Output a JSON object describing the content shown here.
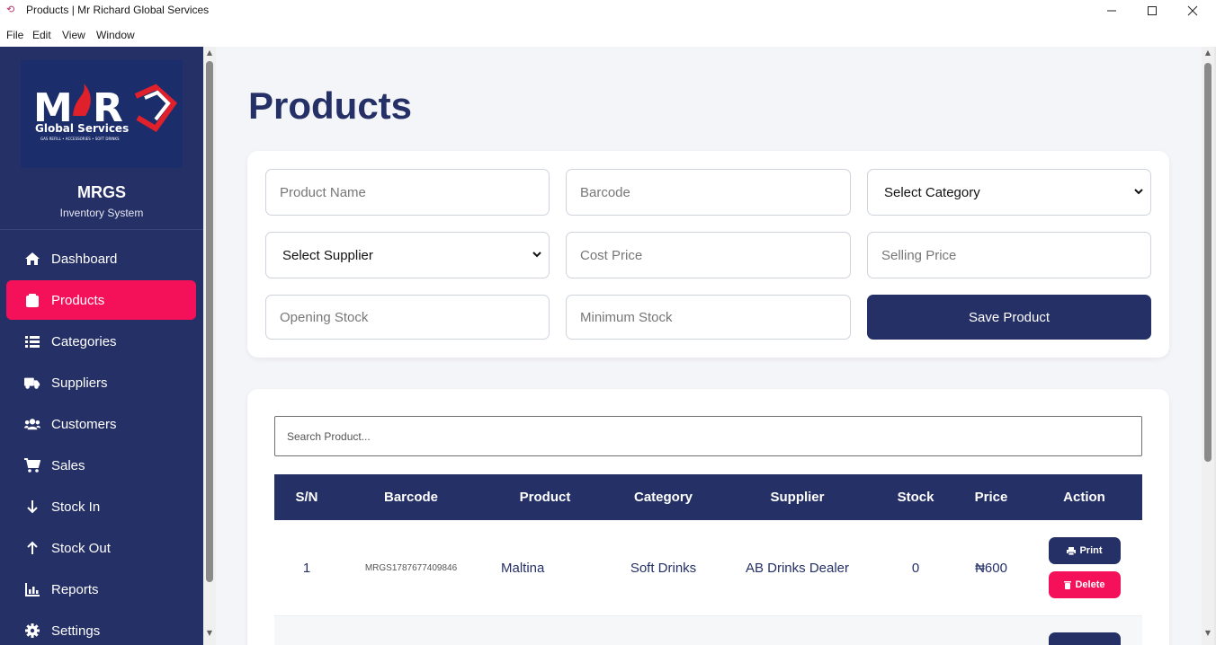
{
  "window": {
    "title": "Products | Mr Richard Global Services",
    "app_icon": "app-logo-icon",
    "controls": [
      "minimize-icon",
      "maximize-icon",
      "close-icon"
    ]
  },
  "menubar": [
    "File",
    "Edit",
    "View",
    "Window"
  ],
  "sidebar": {
    "logo": {
      "line1": "MRGS",
      "line2": "Global Services",
      "tagline": "GAS REFILL • ACCESSORIES • SOFT DRINKS"
    },
    "brand": "MRGS",
    "subtitle": "Inventory System",
    "items": [
      {
        "label": "Dashboard",
        "icon": "home-icon",
        "active": false
      },
      {
        "label": "Products",
        "icon": "box-icon",
        "active": true
      },
      {
        "label": "Categories",
        "icon": "list-icon",
        "active": false
      },
      {
        "label": "Suppliers",
        "icon": "truck-icon",
        "active": false
      },
      {
        "label": "Customers",
        "icon": "users-icon",
        "active": false
      },
      {
        "label": "Sales",
        "icon": "cart-icon",
        "active": false
      },
      {
        "label": "Stock In",
        "icon": "arrow-down-icon",
        "active": false
      },
      {
        "label": "Stock Out",
        "icon": "arrow-up-icon",
        "active": false
      },
      {
        "label": "Reports",
        "icon": "chart-icon",
        "active": false
      },
      {
        "label": "Settings",
        "icon": "gear-icon",
        "active": false
      }
    ]
  },
  "main": {
    "title": "Products",
    "form": {
      "product_name": "Product Name",
      "barcode": "Barcode",
      "category": "Select Category",
      "supplier": "Select Supplier",
      "cost_price": "Cost Price",
      "selling_price": "Selling Price",
      "opening_stock": "Opening Stock",
      "minimum_stock": "Minimum Stock",
      "save_label": "Save Product"
    },
    "search_placeholder": "Search Product...",
    "table": {
      "headers": [
        "S/N",
        "Barcode",
        "Product",
        "Category",
        "Supplier",
        "Stock",
        "Price",
        "Action"
      ],
      "rows": [
        {
          "sn": "1",
          "barcode": "MRGS1787677409846",
          "product": "Maltina",
          "category": "Soft Drinks",
          "supplier": "AB Drinks Dealer",
          "stock": "0",
          "price": "₦600"
        }
      ],
      "print_label": "Print",
      "delete_label": "Delete"
    }
  },
  "colors": {
    "navy": "#253066",
    "accent": "#f5115a",
    "background": "#f4f5f9"
  }
}
